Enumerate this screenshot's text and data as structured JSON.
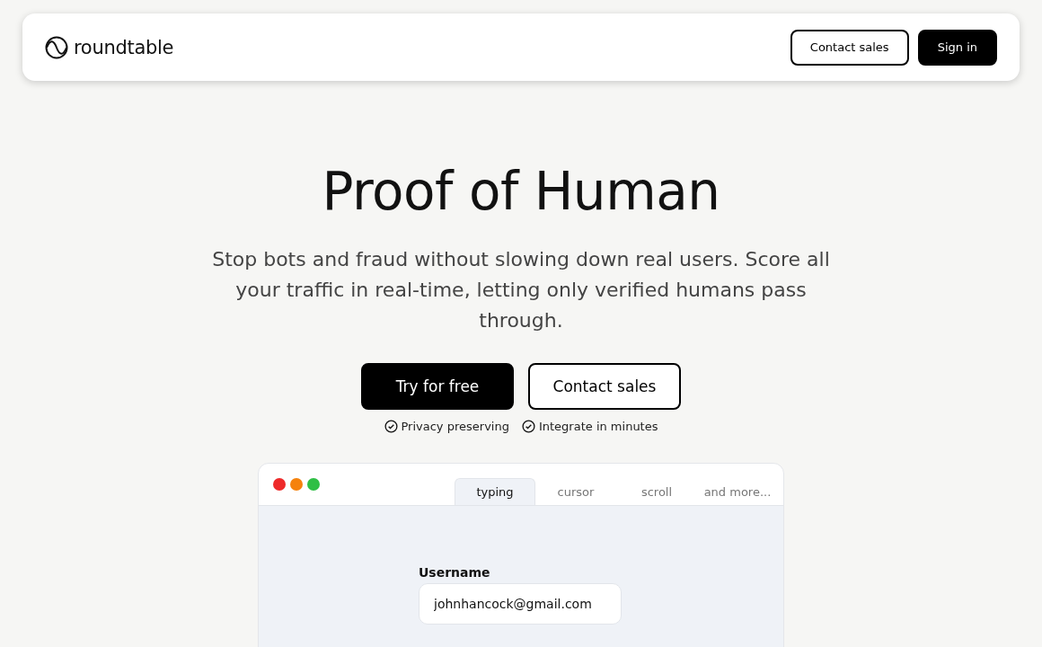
{
  "header": {
    "logo": "roundtable",
    "buttons": [
      {
        "label": "Contact sales",
        "kind": "outline"
      },
      {
        "label": "Sign in",
        "kind": "solid"
      }
    ]
  },
  "hero": {
    "title": "Proof of Human",
    "subtitle": "Stop bots and fraud without slowing down real users. Score all your traffic in real-time, letting only verified humans pass through.",
    "buttons": [
      {
        "label": "Try for free",
        "kind": "solid"
      },
      {
        "label": "Contact sales",
        "kind": "outline"
      }
    ],
    "features": [
      "Privacy preserving",
      "Integrate in minutes"
    ]
  },
  "demo": {
    "dots": [
      {
        "color": "#ee2a2a"
      },
      {
        "color": "#f5820d"
      },
      {
        "color": "#2fbf45"
      }
    ],
    "tabs": [
      {
        "label": "typing",
        "selected": true
      },
      {
        "label": "cursor",
        "selected": false
      },
      {
        "label": "scroll",
        "selected": false
      },
      {
        "label": "and more...",
        "selected": false
      }
    ],
    "field": {
      "label": "Username",
      "value": "johnhancock@gmail.com"
    }
  }
}
